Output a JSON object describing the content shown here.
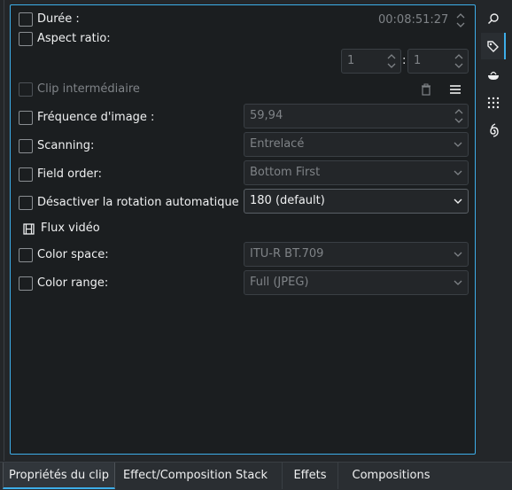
{
  "properties": {
    "duration": {
      "label": "Durée :",
      "value": "00:08:51:27"
    },
    "aspect_ratio": {
      "label": "Aspect ratio:",
      "num": "1",
      "den": "1",
      "sep": ":"
    },
    "proxy_clip": {
      "label": "Clip intermédiaire"
    },
    "frame_rate": {
      "label": "Fréquence d'image :",
      "value": "59,94"
    },
    "scanning": {
      "label": "Scanning:",
      "value": "Entrelacé"
    },
    "field_order": {
      "label": "Field order:",
      "value": "Bottom First"
    },
    "rotation": {
      "label": "Désactiver la rotation automatique",
      "value": "180 (default)"
    },
    "video_stream": {
      "label": "Flux vidéo"
    },
    "color_space": {
      "label": "Color space:",
      "value": "ITU-R BT.709"
    },
    "color_range": {
      "label": "Color range:",
      "value": "Full (JPEG)"
    }
  },
  "sidebar": {
    "icons": [
      "search-icon",
      "tag-icon",
      "bowl-icon",
      "grid-dots-icon",
      "spiral-icon"
    ],
    "selected": "tag-icon"
  },
  "tabs": [
    {
      "label": "Propriétés du clip",
      "selected": true
    },
    {
      "label": "Effect/Composition Stack",
      "selected": false
    },
    {
      "label": "Effets",
      "selected": false
    },
    {
      "label": "Compositions",
      "selected": false
    }
  ],
  "colors": {
    "accent": "#3daee9",
    "background": "#1b1e20",
    "text": "#eff0f1",
    "dim_text": "#7f8387"
  }
}
